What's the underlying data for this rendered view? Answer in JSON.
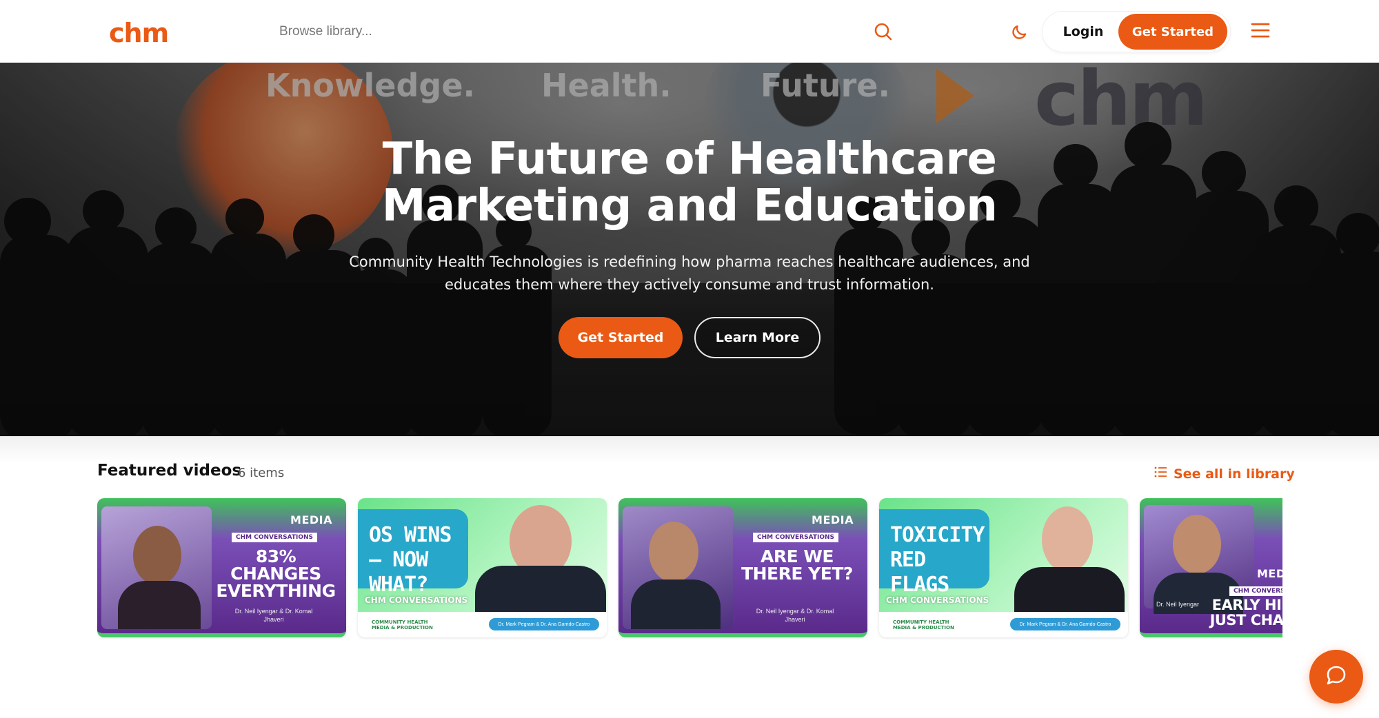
{
  "header": {
    "logo": "chm",
    "search_placeholder": "Browse library...",
    "login_label": "Login",
    "cta_label": "Get Started"
  },
  "hero": {
    "screen_words": [
      "Knowledge.",
      "Health.",
      "Future."
    ],
    "screen_logo": "chm",
    "title_line1": "The Future of Healthcare",
    "title_line2": "Marketing and Education",
    "subtitle_line1": "Community Health Technologies is redefining how pharma reaches healthcare audiences, and",
    "subtitle_line2": "educates them where they actively consume and trust information.",
    "primary_label": "Get Started",
    "secondary_label": "Learn More"
  },
  "featured": {
    "title": "Featured videos",
    "count": "6 items",
    "see_all": "See all in library",
    "cards": [
      {
        "style": "purple",
        "brand": "MEDIA",
        "tag": "CHM CONVERSATIONS",
        "headline": "83% CHANGES EVERYTHING",
        "byline": "Dr. Neil Iyengar & Dr. Komal Jhaveri"
      },
      {
        "style": "green",
        "headline": "OS WINS – NOW WHAT?",
        "tag": "CHM CONVERSATIONS",
        "footer_logo": "COMMUNITY HEALTH MEDIA & PRODUCTION",
        "footer_names": "Dr. Mark Pegram & Dr. Ana Garrido-Castro"
      },
      {
        "style": "purple",
        "brand": "MEDIA",
        "tag": "CHM CONVERSATIONS",
        "headline": "ARE WE THERE YET?",
        "byline": "Dr. Neil Iyengar & Dr. Komal Jhaveri"
      },
      {
        "style": "green",
        "headline": "TOXICITY RED FLAGS",
        "tag": "CHM CONVERSATIONS",
        "footer_logo": "COMMUNITY HEALTH MEDIA & PRODUCTION",
        "footer_names": "Dr. Mark Pegram & Dr. Ana Garrido-Castro"
      },
      {
        "style": "purple",
        "brand": "MEDI",
        "tag": "CHM CONVERSAT",
        "headline": "EARLY HI JUST CHA",
        "byline": "Dr. Neil Iyengar"
      }
    ]
  },
  "colors": {
    "accent": "#ea5a14",
    "card_purple": "#5a2a8a",
    "card_green": "#6ae38a",
    "card_blue": "#27a7c9"
  },
  "icons": {
    "search": "search-icon",
    "theme": "moon-icon",
    "menu": "hamburger-menu-icon",
    "list": "list-icon",
    "chat": "chat-bubble-icon"
  }
}
